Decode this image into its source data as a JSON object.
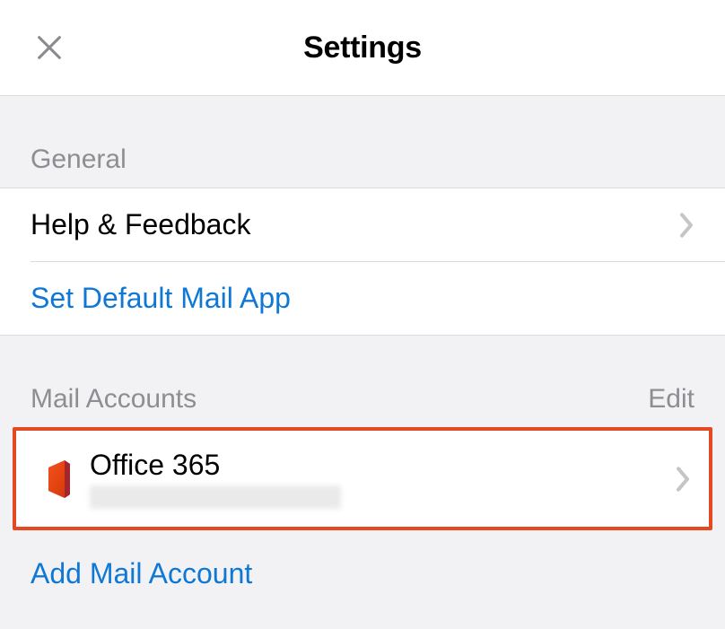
{
  "header": {
    "title": "Settings"
  },
  "sections": {
    "general": {
      "header": "General",
      "help_feedback_label": "Help & Feedback",
      "default_mail_label": "Set Default Mail App"
    },
    "mail_accounts": {
      "header": "Mail Accounts",
      "edit_label": "Edit",
      "account_name": "Office 365",
      "add_account_label": "Add Mail Account"
    }
  }
}
